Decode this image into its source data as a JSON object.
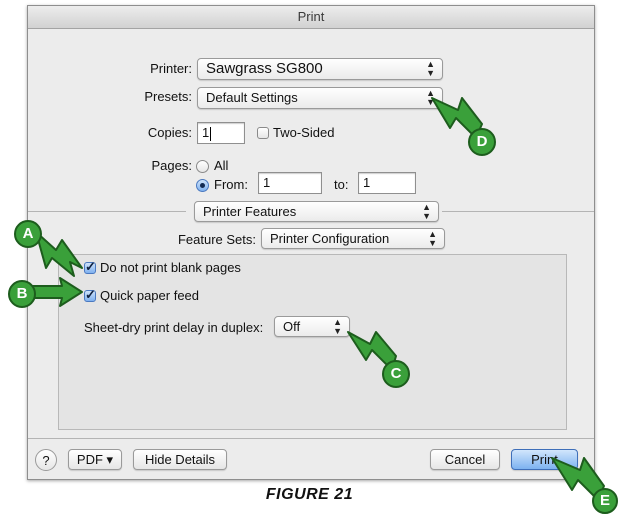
{
  "window": {
    "title": "Print"
  },
  "printer": {
    "label": "Printer:",
    "value": "Sawgrass SG800"
  },
  "presets": {
    "label": "Presets:",
    "value": "Default Settings"
  },
  "copies": {
    "label": "Copies:",
    "value": "1",
    "two_sided_label": "Two-Sided",
    "two_sided_checked": false
  },
  "pages": {
    "label": "Pages:",
    "all_label": "All",
    "from_label": "From:",
    "from_value": "1",
    "to_label": "to:",
    "to_value": "1",
    "selected": "from"
  },
  "section_popup": {
    "value": "Printer Features"
  },
  "feature_sets": {
    "label": "Feature Sets:",
    "value": "Printer Configuration"
  },
  "options": {
    "blank_pages": {
      "label": "Do not print blank pages",
      "checked": true
    },
    "quick_feed": {
      "label": "Quick paper feed",
      "checked": true
    },
    "delay": {
      "label": "Sheet-dry print delay in duplex:",
      "value": "Off"
    }
  },
  "footer": {
    "help": "?",
    "pdf": "PDF ▾",
    "hide_details": "Hide Details",
    "cancel": "Cancel",
    "print": "Print"
  },
  "callouts": [
    "A",
    "B",
    "C",
    "D",
    "E"
  ],
  "caption": "FIGURE 21",
  "colors": {
    "callout_green": "#3aa03a",
    "default_button": "#7db2f0"
  }
}
